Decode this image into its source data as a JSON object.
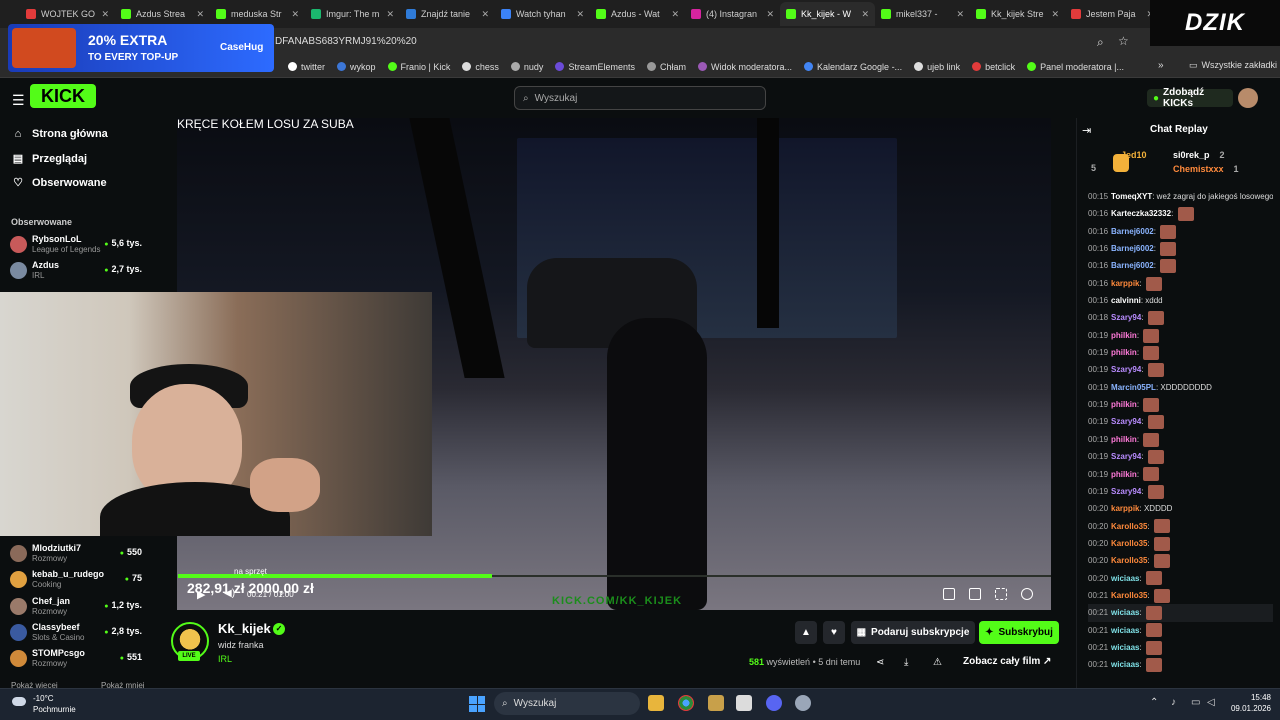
{
  "browser": {
    "tabs": [
      {
        "title": "WOJTEK GO",
        "fav": "#e23b3b"
      },
      {
        "title": "Azdus Strea",
        "fav": "#53fc18"
      },
      {
        "title": "meduska Str",
        "fav": "#53fc18"
      },
      {
        "title": "Imgur: The m",
        "fav": "#1bb76e"
      },
      {
        "title": "Znajdź tanie",
        "fav": "#2f7bd8"
      },
      {
        "title": "Watch tyhan",
        "fav": "#3b82f6"
      },
      {
        "title": "Azdus - Wat",
        "fav": "#53fc18"
      },
      {
        "title": "(4) Instagran",
        "fav": "#d6249f"
      },
      {
        "title": "Kk_kijek - W",
        "fav": "#53fc18"
      },
      {
        "title": "mikel337 -",
        "fav": "#53fc18"
      },
      {
        "title": "Kk_kijek Stre",
        "fav": "#53fc18"
      },
      {
        "title": "Jestem Paja",
        "fav": "#e23b3b"
      }
    ],
    "url": "DFANABS683YRMJ91%20%20",
    "bookmarks": [
      "twitter",
      "wykop",
      "Franio | Kick",
      "chess",
      "nudy",
      "StreamElements",
      "Chłam",
      "Widok moderatora...",
      "Kalendarz Google -...",
      "ujeb link",
      "betclick",
      "Panel moderatora |..."
    ],
    "all_bookmarks": "Wszystkie zakładki"
  },
  "ad": {
    "big": "20% EXTRA",
    "small": "TO EVERY TOP-UP",
    "brand": "CaseHug"
  },
  "overlay_logo": "DZIK",
  "kick": {
    "logo": "KICK",
    "search_placeholder": "Wyszukaj",
    "kicks_button": "Zdobądź KICKs"
  },
  "sidebar": {
    "nav": [
      {
        "label": "Strona główna",
        "icon": "home-icon",
        "glyph": "⌂"
      },
      {
        "label": "Przeglądaj",
        "icon": "browse-icon",
        "glyph": "▤"
      },
      {
        "label": "Obserwowane",
        "icon": "heart-icon",
        "glyph": "♡"
      }
    ],
    "followed_heading": "Obserwowane",
    "channels_top": [
      {
        "name": "RybsonLoL",
        "game": "League of Legends",
        "viewers": "5,6 tys.",
        "color": "#c85a5a"
      },
      {
        "name": "Azdus",
        "game": "IRL",
        "viewers": "2,7 tys.",
        "color": "#7a8aa0"
      }
    ],
    "channels_bottom": [
      {
        "name": "Mlodziutki7",
        "game": "Rozmowy",
        "viewers": "550",
        "color": "#8a6a5a"
      },
      {
        "name": "kebab_u_rudego",
        "game": "Cooking",
        "viewers": "75",
        "color": "#e0a040"
      },
      {
        "name": "Chef_jan",
        "game": "Rozmowy",
        "viewers": "1,2 tys.",
        "color": "#9a7a6a"
      },
      {
        "name": "Classybeef",
        "game": "Slots & Casino",
        "viewers": "2,8 tys.",
        "color": "#3a5aa0"
      },
      {
        "name": "STOMPcsgo",
        "game": "Rozmowy",
        "viewers": "551",
        "color": "#d08a3a"
      }
    ],
    "show_more": "Pokaż więcej",
    "show_less": "Pokaż mniej"
  },
  "video": {
    "overlay_title": "KRĘCE KOŁEM LOSU ZA SUBA",
    "goal_label": "na sprzęt",
    "goal_amounts": "282,91 zł  2000,00 zł",
    "goal_progress": 0.36,
    "time": "00:21 / 01:00",
    "watermark": "KICK.COM/KK_KIJEK"
  },
  "channel": {
    "name": "Kk_kijek",
    "title": "widz franka",
    "category": "IRL",
    "live": "LIVE",
    "gift_sub": "Podaruj subskrypcje",
    "subscribe": "Subskrybuj",
    "views_count": "581",
    "views_label": "wyświetleń",
    "age": "5 dni temu",
    "full_film": "Zobacz cały film"
  },
  "chat": {
    "title": "Chat Replay",
    "leaderboard": [
      {
        "name": "Jed10",
        "count": "5"
      },
      {
        "name": "si0rek_p",
        "count": "2"
      },
      {
        "name": "Chemistxxx",
        "count": "1"
      }
    ],
    "messages": [
      {
        "t": "00:15",
        "u": "TomeqXYT",
        "c": "#ffffff",
        "txt": "weź zagraj do jakiegoś losowego przechodnia o lg",
        "emote": false
      },
      {
        "t": "00:16",
        "u": "Karteczka32332",
        "c": "#ffffff",
        "txt": "",
        "emote": true
      },
      {
        "t": "00:16",
        "u": "Barnej6002",
        "c": "#8ab4ff",
        "txt": "",
        "emote": true
      },
      {
        "t": "00:16",
        "u": "Barnej6002",
        "c": "#8ab4ff",
        "txt": "",
        "emote": true
      },
      {
        "t": "00:16",
        "u": "Barnej6002",
        "c": "#8ab4ff",
        "txt": "",
        "emote": true
      },
      {
        "t": "00:16",
        "u": "karppik",
        "c": "#ff8a3c",
        "txt": "",
        "emote": true
      },
      {
        "t": "00:16",
        "u": "calvinni",
        "c": "#ffffff",
        "txt": "xddd",
        "emote": false
      },
      {
        "t": "00:18",
        "u": "Szary94",
        "c": "#b98cff",
        "txt": "",
        "emote": true
      },
      {
        "t": "00:19",
        "u": "philkin",
        "c": "#ff7ad9",
        "txt": "",
        "emote": true
      },
      {
        "t": "00:19",
        "u": "philkin",
        "c": "#ff7ad9",
        "txt": "",
        "emote": true
      },
      {
        "t": "00:19",
        "u": "Szary94",
        "c": "#b98cff",
        "txt": "",
        "emote": true
      },
      {
        "t": "00:19",
        "u": "Marcin05PL",
        "c": "#8ab4ff",
        "txt": "XDDDDDDDD",
        "emote": false
      },
      {
        "t": "00:19",
        "u": "philkin",
        "c": "#ff7ad9",
        "txt": "",
        "emote": true
      },
      {
        "t": "00:19",
        "u": "Szary94",
        "c": "#b98cff",
        "txt": "",
        "emote": true
      },
      {
        "t": "00:19",
        "u": "philkin",
        "c": "#ff7ad9",
        "txt": "",
        "emote": true
      },
      {
        "t": "00:19",
        "u": "Szary94",
        "c": "#b98cff",
        "txt": "",
        "emote": true
      },
      {
        "t": "00:19",
        "u": "philkin",
        "c": "#ff7ad9",
        "txt": "",
        "emote": true
      },
      {
        "t": "00:19",
        "u": "Szary94",
        "c": "#b98cff",
        "txt": "",
        "emote": true
      },
      {
        "t": "00:20",
        "u": "karppik",
        "c": "#ff8a3c",
        "txt": "XDDDD",
        "emote": false
      },
      {
        "t": "00:20",
        "u": "Karollo35",
        "c": "#ff8a3c",
        "txt": "",
        "emote": true
      },
      {
        "t": "00:20",
        "u": "Karollo35",
        "c": "#ff8a3c",
        "txt": "",
        "emote": true
      },
      {
        "t": "00:20",
        "u": "Karollo35",
        "c": "#ff8a3c",
        "txt": "",
        "emote": true
      },
      {
        "t": "00:20",
        "u": "wiciaas",
        "c": "#7fe0e6",
        "txt": "",
        "emote": true
      },
      {
        "t": "00:21",
        "u": "Karollo35",
        "c": "#ff8a3c",
        "txt": "",
        "emote": true
      },
      {
        "t": "00:21",
        "u": "wiciaas",
        "c": "#7fe0e6",
        "txt": "",
        "emote": true
      },
      {
        "t": "00:21",
        "u": "wiciaas",
        "c": "#7fe0e6",
        "txt": "",
        "emote": true
      },
      {
        "t": "00:21",
        "u": "wiciaas",
        "c": "#7fe0e6",
        "txt": "",
        "emote": true
      },
      {
        "t": "00:21",
        "u": "wiciaas",
        "c": "#7fe0e6",
        "txt": "",
        "emote": true
      }
    ]
  },
  "taskbar": {
    "weather_temp": "-10°C",
    "weather_desc": "Pochmurnie",
    "search": "Wyszukaj",
    "time": "15:48",
    "date": "09.01.2026"
  },
  "colors": {
    "accent": "#53fc18",
    "bg": "#0b0e0f"
  }
}
